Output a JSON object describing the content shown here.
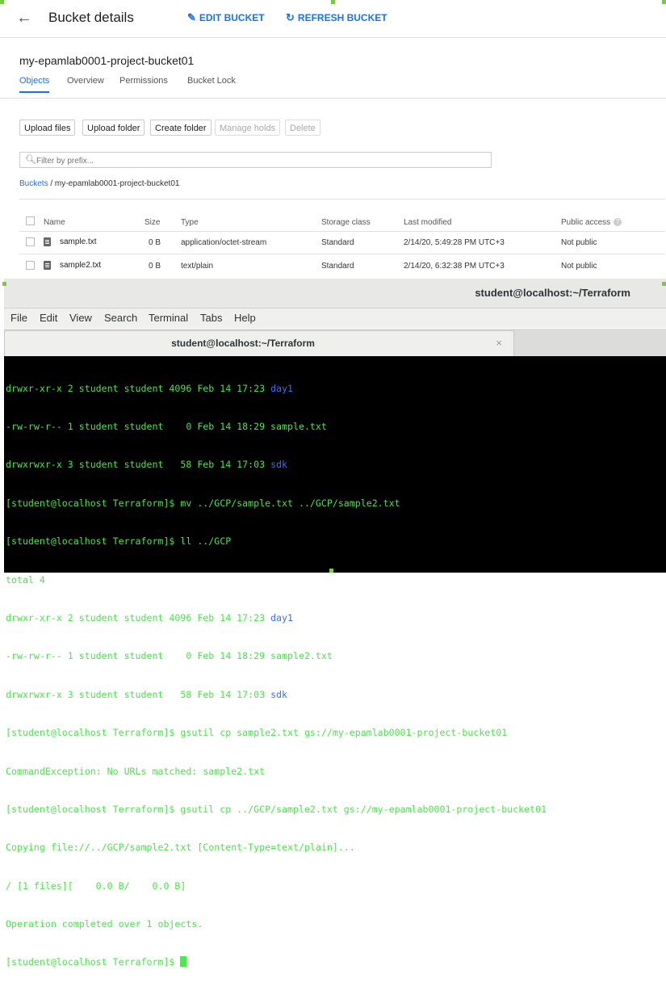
{
  "gcp": {
    "page_title": "Bucket details",
    "edit_label": "EDIT BUCKET",
    "refresh_label": "REFRESH BUCKET",
    "bucket_name": "my-epamlab0001-project-bucket01",
    "tabs": [
      "Objects",
      "Overview",
      "Permissions",
      "Bucket Lock"
    ],
    "active_tab": "Objects",
    "buttons": {
      "upload_files": "Upload files",
      "upload_folder": "Upload folder",
      "create_folder": "Create folder",
      "manage_holds": "Manage holds",
      "delete": "Delete"
    },
    "filter_placeholder": "Filter by prefix...",
    "breadcrumb": {
      "root": "Buckets",
      "separator": "/",
      "current": "my-epamlab0001-project-bucket01"
    },
    "columns": [
      "Name",
      "Size",
      "Type",
      "Storage class",
      "Last modified",
      "Public access"
    ],
    "rows": [
      {
        "name": "sample.txt",
        "size": "0 B",
        "type": "application/octet-stream",
        "storage": "Standard",
        "modified": "2/14/20, 5:49:28 PM UTC+3",
        "access": "Not public"
      },
      {
        "name": "sample2.txt",
        "size": "0 B",
        "type": "text/plain",
        "storage": "Standard",
        "modified": "2/14/20, 6:32:38 PM UTC+3",
        "access": "Not public"
      }
    ],
    "accent_color": "#1a73e8"
  },
  "terminal": {
    "window_title": "student@localhost:~/Terraform",
    "menu": [
      "File",
      "Edit",
      "View",
      "Search",
      "Terminal",
      "Tabs",
      "Help"
    ],
    "tab_title": "student@localhost:~/Terraform",
    "close_glyph": "×",
    "lines": [
      {
        "text": "drwxr-xr-x 2 student student 4096 Feb 14 17:23 ",
        "dir": "day1"
      },
      {
        "text": "-rw-rw-r-- 1 student student    0 Feb 14 18:29 sample.txt",
        "dir": ""
      },
      {
        "text": "drwxrwxr-x 3 student student   58 Feb 14 17:03 ",
        "dir": "sdk"
      },
      {
        "text": "[student@localhost Terraform]$ mv ../GCP/sample.txt ../GCP/sample2.txt",
        "dir": ""
      },
      {
        "text": "[student@localhost Terraform]$ ll ../GCP",
        "dir": ""
      },
      {
        "text": "total 4",
        "dir": ""
      },
      {
        "text": "drwxr-xr-x 2 student student 4096 Feb 14 17:23 ",
        "dir": "day1"
      },
      {
        "text": "-rw-rw-r-- 1 student student    0 Feb 14 18:29 sample2.txt",
        "dir": ""
      },
      {
        "text": "drwxrwxr-x 3 student student   58 Feb 14 17:03 ",
        "dir": "sdk"
      },
      {
        "text": "[student@localhost Terraform]$ gsutil cp sample2.txt gs://my-epamlab0001-project-bucket01",
        "dir": ""
      },
      {
        "text": "CommandException: No URLs matched: sample2.txt",
        "dir": ""
      },
      {
        "text": "[student@localhost Terraform]$ gsutil cp ../GCP/sample2.txt gs://my-epamlab0001-project-bucket01",
        "dir": ""
      },
      {
        "text": "Copying file://../GCP/sample2.txt [Content-Type=text/plain]...",
        "dir": ""
      },
      {
        "text": "/ [1 files][    0.0 B/    0.0 B]",
        "dir": ""
      },
      {
        "text": "Operation completed over 1 objects.",
        "dir": ""
      }
    ],
    "prompt": "[student@localhost Terraform]$ ",
    "text_color": "#4ce34c",
    "dir_color": "#3b6ef5",
    "background": "#000000"
  }
}
